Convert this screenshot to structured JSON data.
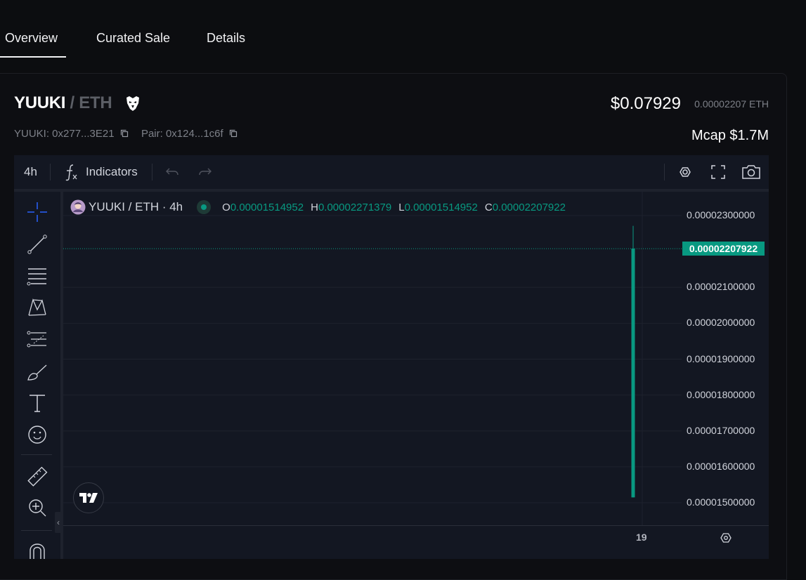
{
  "tabs": [
    {
      "label": "Overview",
      "active": true
    },
    {
      "label": "Curated Sale",
      "active": false
    },
    {
      "label": "Details",
      "active": false
    }
  ],
  "pair": {
    "base": "YUUKI",
    "separator": " / ",
    "quote": "ETH",
    "badge_icon": "eagle-icon"
  },
  "price": {
    "usd": "$0.07929",
    "eth": "0.00002207 ETH"
  },
  "addresses": {
    "token": "YUUKI: 0x277...3E21",
    "pair": "Pair: 0x124...1c6f"
  },
  "mcap": "Mcap $1.7M",
  "toolbar": {
    "interval": "4h",
    "indicators": "Indicators"
  },
  "legend": {
    "symbol": "YUUKI / ETH · 4h",
    "o_label": "O",
    "o": "0.00001514952",
    "h_label": "H",
    "h": "0.00002271379",
    "l_label": "L",
    "l": "0.00001514952",
    "c_label": "C",
    "c": "0.00002207922"
  },
  "colors": {
    "up": "#089981",
    "background": "#131722",
    "text": "#d1d4dc"
  },
  "chart_data": {
    "type": "candlestick",
    "y_ticks": [
      "0.00002300000",
      "0.00002100000",
      "0.00002000000",
      "0.00001900000",
      "0.00001800000",
      "0.00001700000",
      "0.00001600000",
      "0.00001500000"
    ],
    "last_price_label": "0.00002207922",
    "x_tick": "19",
    "ylim": [
      1.45e-05,
      2.32e-05
    ],
    "candles": [
      {
        "open": 1.514952e-05,
        "high": 2.271379e-05,
        "low": 1.514952e-05,
        "close": 2.207922e-05
      }
    ]
  }
}
